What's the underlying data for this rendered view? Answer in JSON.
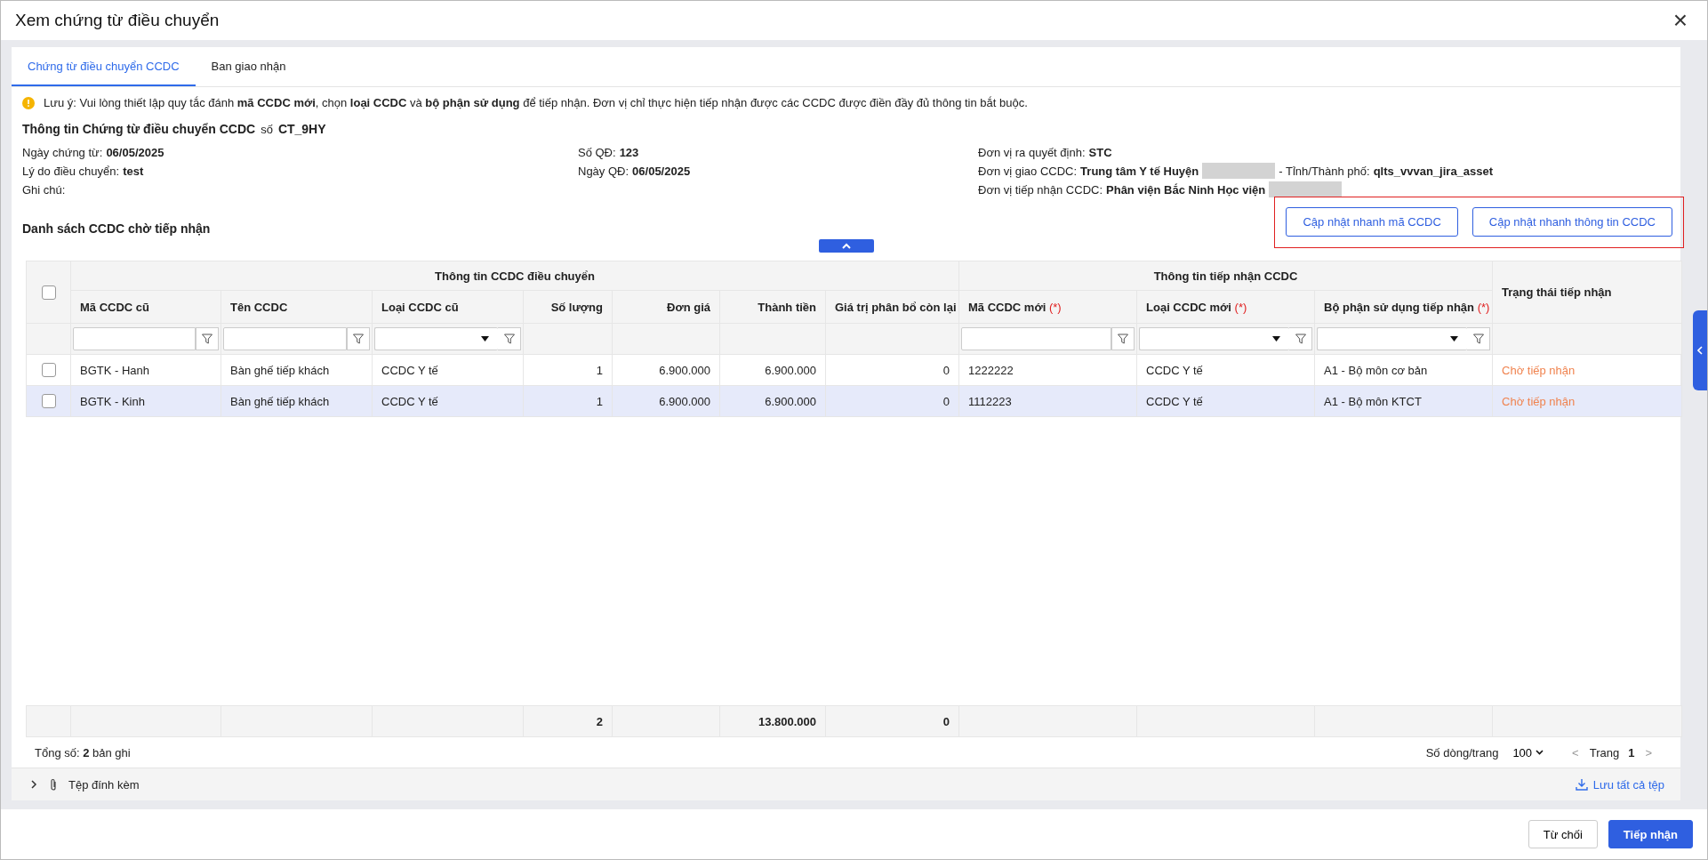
{
  "window": {
    "title": "Xem chứng từ điều chuyển",
    "close": "×"
  },
  "tabs": [
    {
      "label": "Chứng từ điều chuyển CCDC",
      "selected": true
    },
    {
      "label": "Ban giao nhận",
      "selected": false
    }
  ],
  "notice": "Lưu ý: Vui lòng thiết lập quy tắc đánh **mã CCDC mới**, chọn **loại CCDC** và **bộ phận sử dụng** để tiếp nhận. Đơn vị chỉ thực hiện tiếp nhận được các CCDC được điền đầy đủ thông tin bắt buộc.",
  "info": {
    "title": "Thông tin Chứng từ điều chuyển CCDC",
    "number_label": "số",
    "number": "CT_9HY",
    "columns": [
      [
        {
          "label": "Ngày chứng từ:",
          "value": "06/05/2025"
        },
        {
          "label": "Lý do điều chuyển:",
          "value": "test"
        },
        {
          "label": "Ghi chú:"
        }
      ],
      [
        {
          "label": "Số QĐ:",
          "value": "123"
        },
        {
          "label": "Ngày QĐ:",
          "value": "06/05/2025"
        }
      ],
      [
        {
          "label": "Đơn vị ra quyết định:",
          "value": "STC"
        },
        {
          "label": "Đơn vị giao CCDC:",
          "value": "Trung tâm Y tế Huyện",
          "redacted": true,
          "extra_label": "- Tỉnh/Thành phố:",
          "extra_value": "qlts_vvvan_jira_asset"
        },
        {
          "label": "Đơn vị tiếp nhận CCDC:",
          "value": "Phân viện Bắc Ninh Học viện",
          "redacted": true
        }
      ]
    ]
  },
  "list_title": "Danh sách CCDC chờ tiếp nhận",
  "actions": [
    "Cập nhật nhanh mã CCDC",
    "Cập nhật nhanh thông tin CCDC"
  ],
  "table": {
    "select_all": {
      "checked": false
    },
    "groups": [
      {
        "label": "Thông tin CCDC điều chuyển",
        "columns": [
          {
            "label": "Mã CCDC cũ",
            "kind": "text",
            "filter": {
              "kind": "text"
            },
            "required": false
          },
          {
            "label": "Tên CCDC",
            "kind": "text",
            "filter": {
              "kind": "text"
            },
            "required": false
          },
          {
            "label": "Loại CCDC cũ",
            "kind": "text",
            "filter": {
              "kind": "select"
            },
            "required": false
          },
          {
            "label": "Số lượng",
            "kind": "number",
            "required": false,
            "total": "2"
          },
          {
            "label": "Đơn giá",
            "kind": "number",
            "required": false
          },
          {
            "label": "Thành tiền",
            "kind": "number",
            "required": false,
            "total": "13.800.000"
          },
          {
            "label": "Giá trị phân bổ còn lại",
            "kind": "number",
            "required": false,
            "total": "0"
          }
        ]
      },
      {
        "label": "Thông tin tiếp nhận CCDC",
        "columns": [
          {
            "label": "Mã CCDC mới",
            "kind": "text",
            "filter": {
              "kind": "text"
            },
            "required": true
          },
          {
            "label": "Loại CCDC mới",
            "kind": "text",
            "filter": {
              "kind": "select"
            },
            "required": true
          },
          {
            "label": "Bộ phận sử dụng tiếp nhận",
            "kind": "text",
            "filter": {
              "kind": "select"
            },
            "required": true
          }
        ]
      }
    ],
    "status_header": "Trạng thái tiếp nhận",
    "required_mark": "(*)",
    "rows": [
      {
        "checked": false,
        "selected": false,
        "cells": [
          "BGTK - Hanh",
          "Bàn ghế tiếp khách",
          "CCDC Y tế",
          "1",
          "6.900.000",
          "6.900.000",
          "0",
          "1222222",
          "CCDC Y tế",
          "A1 - Bộ môn cơ bản"
        ],
        "status": "Chờ tiếp nhận"
      },
      {
        "checked": false,
        "selected": true,
        "cells": [
          "BGTK - Kinh",
          "Bàn ghế tiếp khách",
          "CCDC Y tế",
          "1",
          "6.900.000",
          "6.900.000",
          "0",
          "1112223",
          "CCDC Y tế",
          "A1 - Bộ môn KTCT"
        ],
        "status": "Chờ tiếp nhận"
      }
    ]
  },
  "pager": {
    "total_label": "Tổng số:",
    "total": "2",
    "total_unit": "bản ghi",
    "page_size_label": "Số dòng/trang",
    "page_size": "100",
    "prev": "<",
    "page_label": "Trang",
    "page": "1",
    "next": ">"
  },
  "attachments": {
    "label": "Tệp đính kèm",
    "expanded": false,
    "save_all": "Lưu tất cả tệp"
  },
  "buttons": [
    {
      "label": "Từ chối",
      "kind": "secondary"
    },
    {
      "label": "Tiếp nhận",
      "kind": "primary"
    }
  ]
}
